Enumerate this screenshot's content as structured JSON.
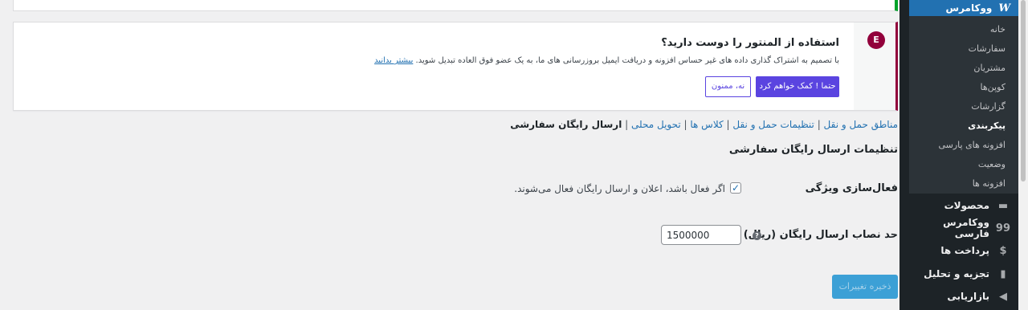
{
  "sidebar": {
    "active_menu": {
      "icon": "woocommerce-icon",
      "icon_glyph": "W",
      "label": "ووکامرس"
    },
    "submenu": [
      {
        "label": "خانه"
      },
      {
        "label": "سفارشات"
      },
      {
        "label": "مشتریان"
      },
      {
        "label": "کوپن‌ها"
      },
      {
        "label": "گزارشات"
      },
      {
        "label": "پیکربندی"
      },
      {
        "label": "افزونه های پارسی"
      },
      {
        "label": "وضعیت"
      },
      {
        "label": "افزونه ها"
      }
    ],
    "menu": [
      {
        "label": "محصولات",
        "icon": "products-icon",
        "glyph": "▬"
      },
      {
        "label": "ووکامرس فارسی",
        "icon": "woocommerce-persian-icon",
        "glyph": "99"
      },
      {
        "label": "پرداخت ها",
        "icon": "payments-icon",
        "glyph": "$"
      },
      {
        "label": "تجزیه و تحلیل",
        "icon": "analytics-icon",
        "glyph": "▮"
      },
      {
        "label": "بازاریابی",
        "icon": "marketing-icon",
        "glyph": "◀"
      }
    ]
  },
  "elementor_notice": {
    "icon_glyph": "E",
    "title": "استفاده از المنتور را دوست دارید؟",
    "description": "با تصمیم به اشتراک گذاری داده های غیر حساس افزونه و دریافت ایمیل بروزرسانی های ما، به یک عضو فوق العاده تبدیل شوید.",
    "learn_more": "بیشتر بدانید",
    "yes_button": "حتما ! کمک خواهم کرد",
    "no_button": "نه، ممنون"
  },
  "subnav": {
    "items": [
      {
        "label": "مناطق حمل و نقل"
      },
      {
        "label": "تنظیمات حمل و نقل"
      },
      {
        "label": "کلاس ها"
      },
      {
        "label": "تحویل محلی"
      }
    ],
    "current": "ارسال رایگان سفارشی",
    "separator": " | "
  },
  "settings": {
    "section_title": "تنظیمات ارسال رایگان سفارشی",
    "enable_label": "فعال‌سازی ویژگی",
    "enable_checked": true,
    "enable_description": "اگر فعال باشد، اعلان و ارسال رایگان فعال می‌شوند.",
    "min_amount_label": "حد نصاب ارسال رایگان (ریال)",
    "min_amount_value": "1500000",
    "help_glyph": "?",
    "save_button": "ذخیره تغییرات"
  },
  "colors": {
    "sidebar_bg": "#1d2327",
    "accent": "#2271b1",
    "elementor_brand": "#92003b",
    "elementor_button": "#5a44e0",
    "success_border": "#00a32a"
  }
}
